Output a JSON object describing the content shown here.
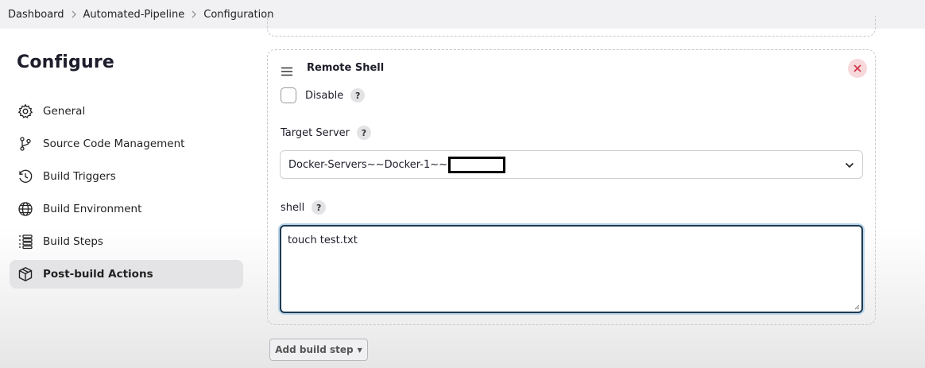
{
  "breadcrumb": {
    "items": [
      "Dashboard",
      "Automated-Pipeline",
      "Configuration"
    ]
  },
  "page": {
    "title": "Configure"
  },
  "sidebar": {
    "items": [
      {
        "label": "General",
        "icon": "gear-icon"
      },
      {
        "label": "Source Code Management",
        "icon": "branch-icon"
      },
      {
        "label": "Build Triggers",
        "icon": "clock-icon"
      },
      {
        "label": "Build Environment",
        "icon": "globe-icon"
      },
      {
        "label": "Build Steps",
        "icon": "list-icon"
      },
      {
        "label": "Post-build Actions",
        "icon": "package-icon",
        "active": true
      }
    ]
  },
  "remote_shell": {
    "title": "Remote Shell",
    "disable_label": "Disable",
    "disable_checked": false,
    "help_glyph": "?",
    "target_server_label": "Target Server",
    "target_server_value": "Docker-Servers~~Docker-1~~",
    "shell_label": "shell",
    "shell_value": "touch test.txt"
  },
  "actions": {
    "add_build_step": "Add build step"
  },
  "colors": {
    "accent_focus": "#1f3a4e",
    "close_bg": "#f7d9dc",
    "close_x": "#d0344a",
    "active_item_bg": "#e4e4e6"
  }
}
